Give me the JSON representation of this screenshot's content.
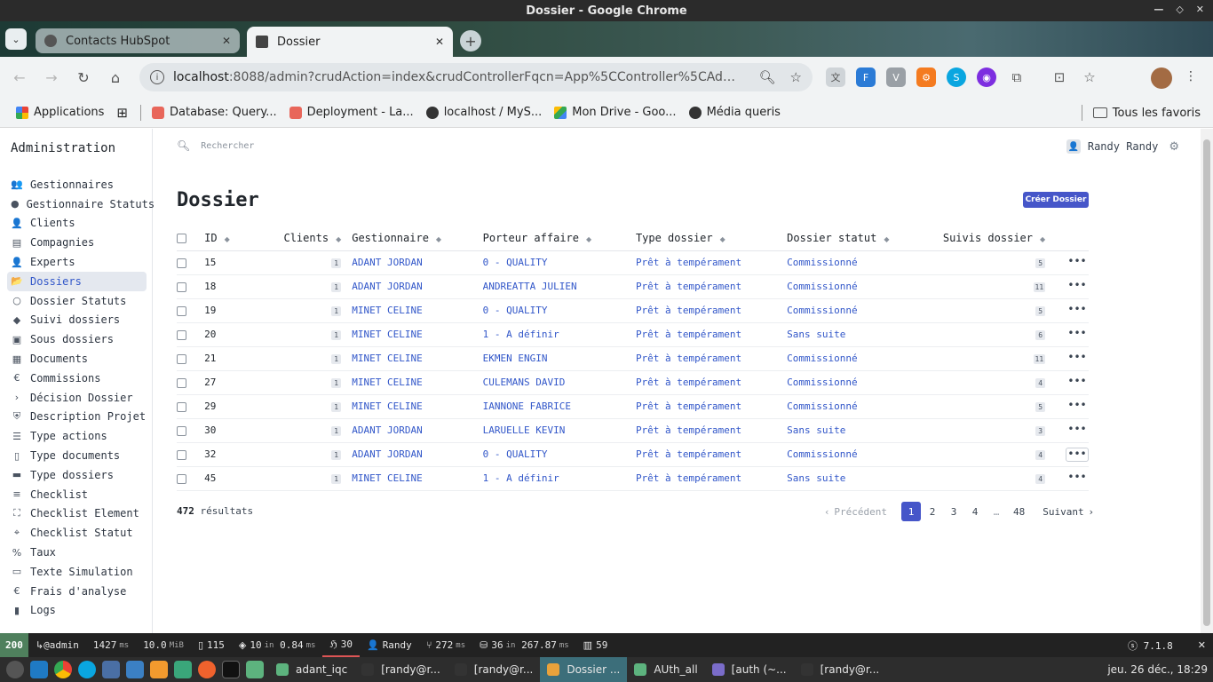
{
  "window": {
    "title": "Dossier - Google Chrome"
  },
  "tabs": [
    {
      "label": "Contacts HubSpot",
      "active": false
    },
    {
      "label": "Dossier",
      "active": true
    }
  ],
  "address": {
    "host": "localhost",
    "path": ":8088/admin?crudAction=index&crudControllerFqcn=App%5CController%5CAdmi..."
  },
  "bookmarks": {
    "items": [
      "Applications",
      "Database: Query...",
      "Deployment - La...",
      "localhost / MyS...",
      "Mon Drive - Goo...",
      "Média queris"
    ],
    "all_label": "Tous les favoris"
  },
  "sidebar": {
    "brand": "Administration",
    "items": [
      {
        "label": "Gestionnaires",
        "icon": "users-icon",
        "glyph": "👥"
      },
      {
        "label": "Gestionnaire Statuts",
        "icon": "circle-icon",
        "glyph": "●"
      },
      {
        "label": "Clients",
        "icon": "user-icon",
        "glyph": "👤"
      },
      {
        "label": "Compagnies",
        "icon": "chart-icon",
        "glyph": "▤"
      },
      {
        "label": "Experts",
        "icon": "user-tie-icon",
        "glyph": "👤"
      },
      {
        "label": "Dossiers",
        "icon": "folder-open-icon",
        "glyph": "📂",
        "active": true
      },
      {
        "label": "Dossier Statuts",
        "icon": "circle-outline-icon",
        "glyph": "○"
      },
      {
        "label": "Suivi dossiers",
        "icon": "diamond-icon",
        "glyph": "◆"
      },
      {
        "label": "Sous dossiers",
        "icon": "folder-plus-icon",
        "glyph": "▣"
      },
      {
        "label": "Documents",
        "icon": "documents-icon",
        "glyph": "▦"
      },
      {
        "label": "Commissions",
        "icon": "euro-icon",
        "glyph": "€"
      },
      {
        "label": "Décision Dossier",
        "icon": "chevron-right-icon",
        "glyph": "›"
      },
      {
        "label": "Description Projet",
        "icon": "shield-icon",
        "glyph": "⛨"
      },
      {
        "label": "Type actions",
        "icon": "list-icon",
        "glyph": "☰"
      },
      {
        "label": "Type documents",
        "icon": "file-icon",
        "glyph": "▯"
      },
      {
        "label": "Type dossiers",
        "icon": "folder-icon",
        "glyph": "▬"
      },
      {
        "label": "Checklist",
        "icon": "bars-icon",
        "glyph": "≡"
      },
      {
        "label": "Checklist Element",
        "icon": "expand-icon",
        "glyph": "⛶"
      },
      {
        "label": "Checklist Statut",
        "icon": "crosshair-icon",
        "glyph": "⌖"
      },
      {
        "label": "Taux",
        "icon": "percent-icon",
        "glyph": "%"
      },
      {
        "label": "Texte Simulation",
        "icon": "text-icon",
        "glyph": "▭"
      },
      {
        "label": "Frais d'analyse",
        "icon": "euro-icon",
        "glyph": "€"
      },
      {
        "label": "Logs",
        "icon": "clipboard-icon",
        "glyph": "▮"
      }
    ]
  },
  "header": {
    "search_placeholder": "Rechercher",
    "user_name": "Randy Randy"
  },
  "page": {
    "title": "Dossier",
    "create_label": "Créer Dossier"
  },
  "table": {
    "columns": [
      "ID",
      "Clients",
      "Gestionnaire",
      "Porteur affaire",
      "Type dossier",
      "Dossier statut",
      "Suivis dossier"
    ],
    "rows": [
      {
        "id": "15",
        "clients": "1",
        "gestionnaire": "ADANT JORDAN",
        "porteur": "0 - QUALITY",
        "type": "Prêt à tempérament",
        "statut": "Commissionné",
        "suivis": "5"
      },
      {
        "id": "18",
        "clients": "1",
        "gestionnaire": "ADANT JORDAN",
        "porteur": "ANDREATTA JULIEN",
        "type": "Prêt à tempérament",
        "statut": "Commissionné",
        "suivis": "11"
      },
      {
        "id": "19",
        "clients": "1",
        "gestionnaire": "MINET CELINE",
        "porteur": "0 - QUALITY",
        "type": "Prêt à tempérament",
        "statut": "Commissionné",
        "suivis": "5"
      },
      {
        "id": "20",
        "clients": "1",
        "gestionnaire": "MINET CELINE",
        "porteur": "1 - A définir",
        "type": "Prêt à tempérament",
        "statut": "Sans suite",
        "suivis": "6"
      },
      {
        "id": "21",
        "clients": "1",
        "gestionnaire": "MINET CELINE",
        "porteur": "EKMEN ENGIN",
        "type": "Prêt à tempérament",
        "statut": "Commissionné",
        "suivis": "11"
      },
      {
        "id": "27",
        "clients": "1",
        "gestionnaire": "MINET CELINE",
        "porteur": "CULEMANS DAVID",
        "type": "Prêt à tempérament",
        "statut": "Commissionné",
        "suivis": "4"
      },
      {
        "id": "29",
        "clients": "1",
        "gestionnaire": "MINET CELINE",
        "porteur": "IANNONE FABRICE",
        "type": "Prêt à tempérament",
        "statut": "Commissionné",
        "suivis": "5"
      },
      {
        "id": "30",
        "clients": "1",
        "gestionnaire": "ADANT JORDAN",
        "porteur": "LARUELLE KEVIN",
        "type": "Prêt à tempérament",
        "statut": "Sans suite",
        "suivis": "3"
      },
      {
        "id": "32",
        "clients": "1",
        "gestionnaire": "ADANT JORDAN",
        "porteur": "0 - QUALITY",
        "type": "Prêt à tempérament",
        "statut": "Commissionné",
        "suivis": "4",
        "hover": true
      },
      {
        "id": "45",
        "clients": "1",
        "gestionnaire": "MINET CELINE",
        "porteur": "1 - A définir",
        "type": "Prêt à tempérament",
        "statut": "Sans suite",
        "suivis": "4"
      }
    ]
  },
  "footer": {
    "count": "472",
    "count_label": "résultats",
    "pagination": {
      "prev": "Précédent",
      "pages": [
        "1",
        "2",
        "3",
        "4",
        "…",
        "48"
      ],
      "current": "1",
      "next": "Suivant"
    }
  },
  "profiler": {
    "status": "200",
    "route": "@admin",
    "time": "1427",
    "time_unit": "ms",
    "memory": "10.0",
    "memory_unit": "MiB",
    "requests": "115",
    "cache_calls": "10",
    "cache_in": "in",
    "cache_time": "0.84",
    "cache_unit": "ms",
    "security": "30",
    "user": "Randy",
    "twig_time": "272",
    "twig_unit": "ms",
    "db_queries": "36",
    "db_in": "in",
    "db_time": "267.87",
    "db_unit": "ms",
    "forms": "59",
    "version": "7.1.8"
  },
  "taskbar": {
    "apps": [
      "adant_iqc",
      "[randy@r...",
      "[randy@r...",
      "Dossier ...",
      "AUth_all",
      "[auth (~...",
      "[randy@r..."
    ],
    "active_app": "Dossier ...",
    "clock": "jeu. 26 déc., 18:29"
  },
  "colors": {
    "accent": "#4656c9",
    "link": "#3257c9",
    "status_ok": "#4f805d"
  }
}
